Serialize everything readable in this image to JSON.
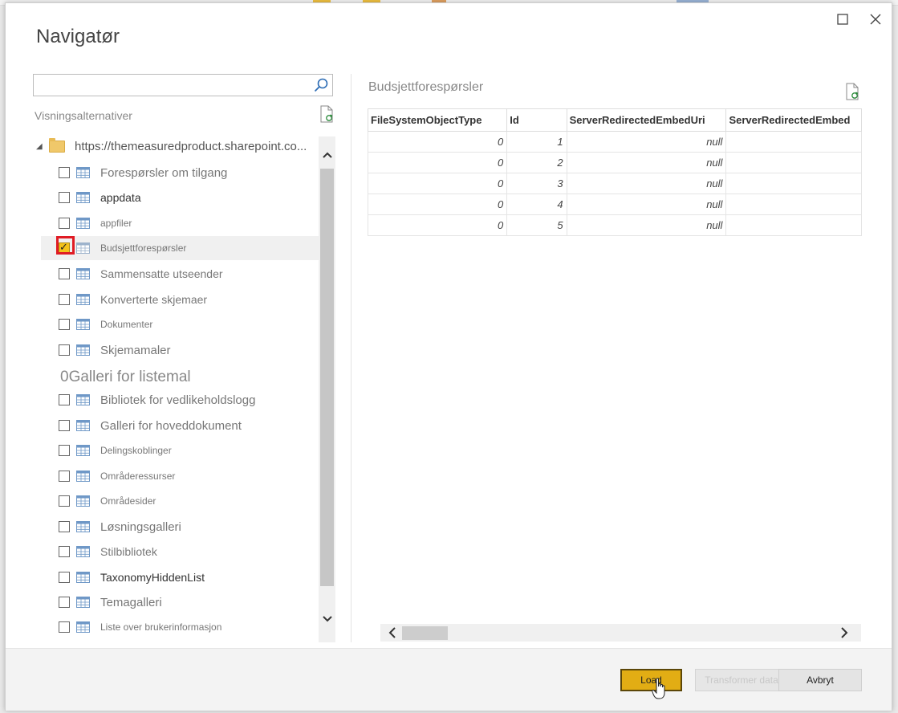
{
  "dialog": {
    "title": "Navigatør",
    "search": {
      "value": "",
      "placeholder": ""
    },
    "view_options_label": "Visningsalternativer",
    "tree_root_label": "https://themeasuredproduct.sharepoint.co...",
    "items": [
      {
        "label": "Forespørsler om tilgang",
        "checked": false
      },
      {
        "label": "appdata",
        "checked": false
      },
      {
        "label": "appfiler",
        "checked": false
      },
      {
        "label": "Budsjettforespørsler",
        "checked": true
      },
      {
        "label": "Sammensatte utseender",
        "checked": false
      },
      {
        "label": "Konverterte skjemaer",
        "checked": false
      },
      {
        "label": "Dokumenter",
        "checked": false
      },
      {
        "label": "Skjemamaler",
        "checked": false
      },
      {
        "label": "Bibliotek for vedlikeholdslogg",
        "checked": false
      },
      {
        "label": "Galleri for hoveddokument",
        "checked": false
      },
      {
        "label": "Delingskoblinger",
        "checked": false
      },
      {
        "label": "Områderessurser",
        "checked": false
      },
      {
        "label": "Områdesider",
        "checked": false
      },
      {
        "label": "Løsningsgalleri",
        "checked": false
      },
      {
        "label": "Stilbibliotek",
        "checked": false
      },
      {
        "label": "TaxonomyHiddenList",
        "checked": false
      },
      {
        "label": "Temagalleri",
        "checked": false
      },
      {
        "label": "Liste over brukerinformasjon",
        "checked": false
      }
    ],
    "section_heading": "0Galleri for listemal",
    "preview": {
      "title": "Budsjettforespørsler",
      "columns": [
        "FileSystemObjectType",
        "Id",
        "ServerRedirectedEmbedUri",
        "ServerRedirectedEmbed"
      ],
      "rows": [
        [
          "0",
          "1",
          "null",
          ""
        ],
        [
          "0",
          "2",
          "null",
          ""
        ],
        [
          "0",
          "3",
          "null",
          ""
        ],
        [
          "0",
          "4",
          "null",
          ""
        ],
        [
          "0",
          "5",
          "null",
          ""
        ]
      ]
    },
    "buttons": {
      "load": "Load",
      "transform": "Transformer data",
      "cancel": "Avbryt"
    },
    "accent_color": "#e2ad14",
    "highlight_color": "#e01b24"
  }
}
